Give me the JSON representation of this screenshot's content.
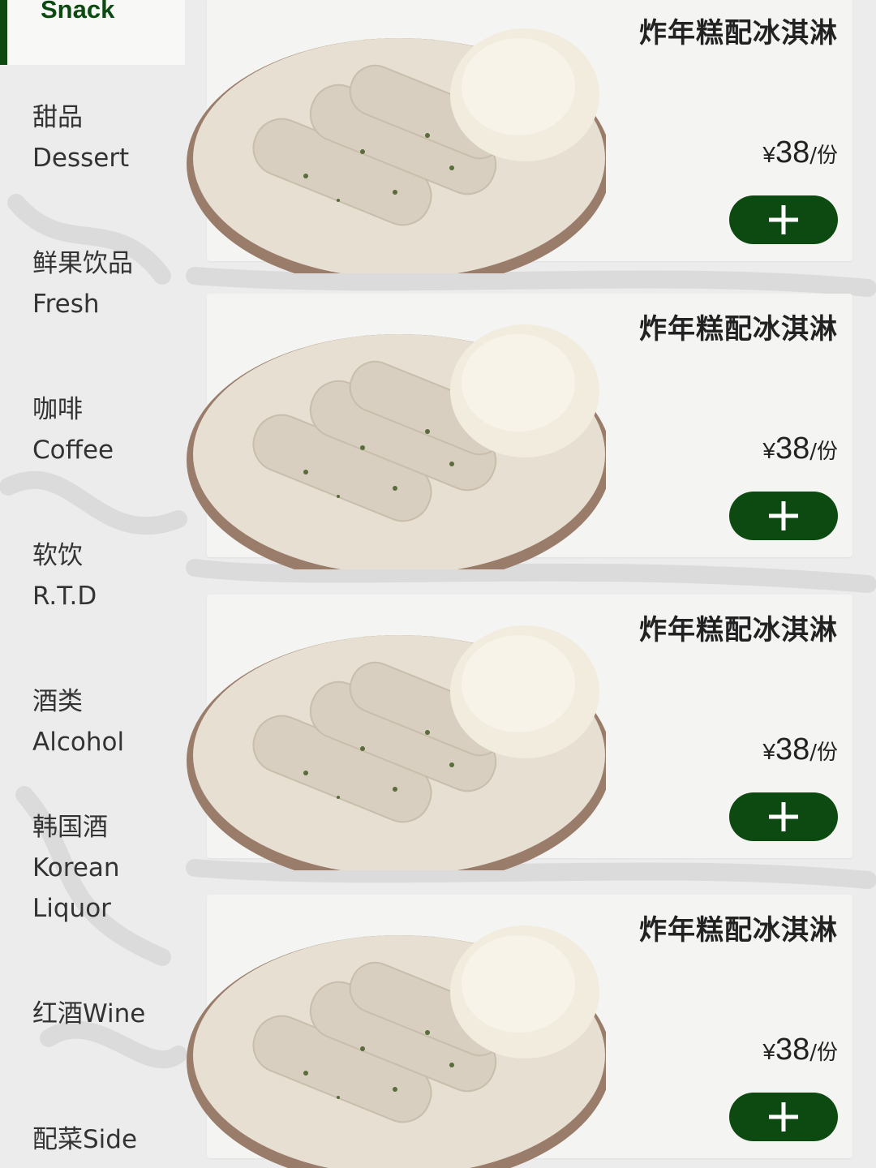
{
  "sidebar": {
    "active": {
      "label": "Snack"
    },
    "items": [
      {
        "cn": "甜品",
        "en": "Dessert"
      },
      {
        "cn": "鲜果饮品",
        "en": "Fresh"
      },
      {
        "cn": "咖啡",
        "en": "Coffee"
      },
      {
        "cn": "软饮",
        "en": "R.T.D"
      },
      {
        "cn": "酒类",
        "en": "Alcohol"
      },
      {
        "cn": "韩国酒",
        "en": "Korean",
        "en2": "Liquor"
      },
      {
        "cn": "红酒Wine"
      },
      {
        "cn": "配菜Side"
      }
    ]
  },
  "products": [
    {
      "name": "炸年糕配冰淇淋",
      "currency": "¥",
      "price": "38",
      "unit": "/份"
    },
    {
      "name": "炸年糕配冰淇淋",
      "currency": "¥",
      "price": "38",
      "unit": "/份"
    },
    {
      "name": "炸年糕配冰淇淋",
      "currency": "¥",
      "price": "38",
      "unit": "/份"
    },
    {
      "name": "炸年糕配冰淇淋",
      "currency": "¥",
      "price": "38",
      "unit": "/份"
    }
  ],
  "colors": {
    "accent": "#0d4a12",
    "background": "#ececec",
    "card": "#f4f4f2"
  },
  "icons": {
    "add": "plus-icon"
  }
}
